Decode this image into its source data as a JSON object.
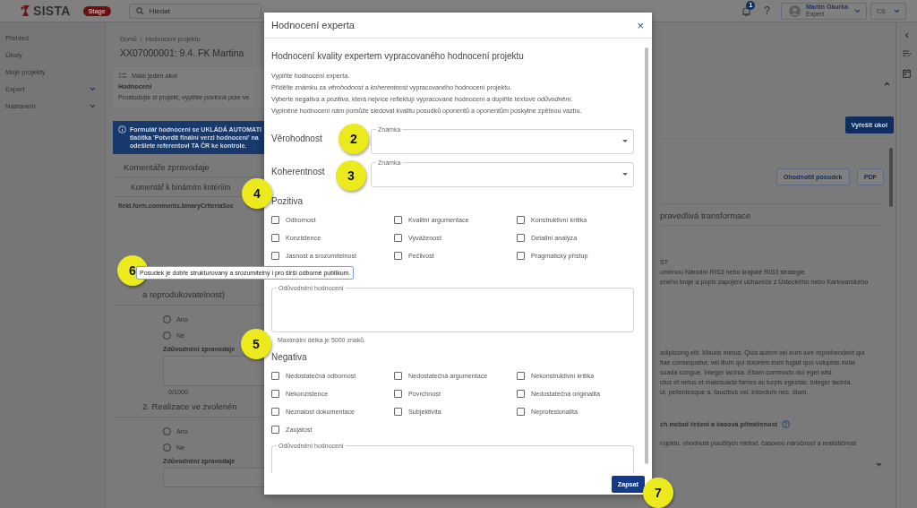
{
  "header": {
    "logo": "SISTA",
    "env_badge": "Stage",
    "search": {
      "placeholder": "Hledat"
    },
    "notifications": "1",
    "help": "?",
    "user": {
      "name": "Martin Okurka",
      "role": "Expert"
    },
    "language": "CS"
  },
  "sidebar": {
    "items": [
      {
        "label": "Přehled",
        "expandable": false
      },
      {
        "label": "Úkoly",
        "expandable": false
      },
      {
        "label": "Moje projekty",
        "expandable": false
      },
      {
        "label": "Expert",
        "expandable": true
      },
      {
        "label": "Nastavení",
        "expandable": true
      }
    ]
  },
  "page": {
    "breadcrumb": [
      "Domů",
      "Hodnocení projektu"
    ],
    "breadcrumb_separator": "/",
    "title": "XX07000001: 9.4. FK Martina",
    "task": {
      "heading": "Máte jeden úkol",
      "name": "Hodnocení",
      "text": "Prostudujte si projekt, vyplňte povinná pole ve",
      "expanded": true,
      "action": "Vyřešit úkol"
    },
    "alert": [
      "Formulář hodnocení se UKLÁDÁ AUTOMATI",
      "tlačítka 'Potvrdit finální verzi hodnocení' na",
      "odešlete referentovi TA ČR ke kontrole."
    ],
    "buttons": [
      "Ohodnotit posudek",
      "PDF"
    ],
    "section_title": "Komentáře zpravodaje",
    "tab_fragment": "pravedlivá transformace",
    "subsection": "Komentář k binárním kritériím",
    "field_key": "field.form.comments.binaryCriteriaSec",
    "criteria": [
      {
        "title": "a reprodukovatelnost)",
        "options": [
          {
            "label": "Ano",
            "selected": false
          },
          {
            "label": "Ne",
            "selected": false
          }
        ],
        "justification_label": "Zdůvodnění zpravodaje",
        "counter": "0/1000"
      },
      {
        "title": "2. Realizace ve zvolenén",
        "options": [
          {
            "label": "Ano",
            "selected": false
          },
          {
            "label": "Ne",
            "selected": false
          }
        ],
        "justification_label": "Zdůvodnění zpravodaje"
      }
    ],
    "right_panel": {
      "top_lines": [
        "ST",
        "oménou Národní RIS3 nebo krajské RIS3 strategie",
        "eného kraje a popis zapojení uchazeče z Ústeckého nebo Karlovarského"
      ],
      "lorem_lines": [
        "adipiscing elit. Mauris metus. Quis autem vel eum iure reprehenderit qui",
        "tiae consequatur, vel illum qui dolorem eum fugiat quo voluptas nulla",
        "suada congue. Integer lacinia. Etiam commodo dui eget wisi.",
        "ctus et netus et malesuada fames ac turpis egestas. Integer lacinia.",
        "ui, pellentesque a, faucibus vel, interdum nec, diam."
      ],
      "criterion_heading": "ch metod řešení a časová přiměřenost",
      "criterion_text": "rojektu, vhodnost použitých metod, časovou náročnost a realističnost"
    }
  },
  "modal": {
    "title": "Hodnocení experta",
    "close": "×",
    "heading": "Hodnocení kvality expertem vypracovaného hodnocení projektu",
    "intro": [
      "Vyplňte hodnocení experta.",
      "Přidělte známku za *věrohodnost* a *koherentnost* vypracovaného hodnocení projektu.",
      "Vyberte negativa a *pozitiva*, která nejvíce reflektují vypracované hodnocení a doplňte textové *odůvodnění*.",
      "Vyplněné hodnocení nám pomůže sledovat kvalitu posudků oponentů a oponentům poskytne zpětnou vazbu."
    ],
    "grades": [
      {
        "label": "Věrohodnost",
        "field_label": "Známka"
      },
      {
        "label": "Koherentnost",
        "field_label": "Známka"
      }
    ],
    "positives_title": "Pozitiva",
    "positives": [
      {
        "label": "Odbornost",
        "checked": false
      },
      {
        "label": "Kvalitní argumentace",
        "checked": false
      },
      {
        "label": "Konstruktivní kritika",
        "checked": false
      },
      {
        "label": "Konzistence",
        "checked": false
      },
      {
        "label": "Vyváženost",
        "checked": false
      },
      {
        "label": "Detailní analýza",
        "checked": false
      },
      {
        "label": "Jasnost a srozumitelnost",
        "checked": false
      },
      {
        "label": "Pečlivost",
        "checked": false
      },
      {
        "label": "Pragmatický přístup",
        "checked": false
      }
    ],
    "positives_reason": {
      "label": "Odůvodnění hodnocení",
      "hint": "Maximální délka je 5000 znaků."
    },
    "negatives_title": "Negativa",
    "negatives": [
      {
        "label": "Nedostatečná odbornost",
        "checked": false
      },
      {
        "label": "Nedostatečná argumentace",
        "checked": false
      },
      {
        "label": "Nekonstruktivní kritika",
        "checked": false
      },
      {
        "label": "Nekonzistence",
        "checked": false
      },
      {
        "label": "Povrchnost",
        "checked": false
      },
      {
        "label": "Nedostatečná originalita",
        "checked": false
      },
      {
        "label": "Neznalost dokumentace",
        "checked": false
      },
      {
        "label": "Subjektivita",
        "checked": false
      },
      {
        "label": "Neprofesionalita",
        "checked": false
      },
      {
        "label": "Zaujatost",
        "checked": false
      }
    ],
    "negatives_reason": {
      "label": "Odůvodnění hodnocení"
    },
    "submit": "Zapsat"
  },
  "tooltip": "Posudek je dobře strukturovaný a srozumitelný i pro širší odborné publikum.",
  "callouts": [
    "2",
    "3",
    "4",
    "5",
    "6",
    "7"
  ]
}
